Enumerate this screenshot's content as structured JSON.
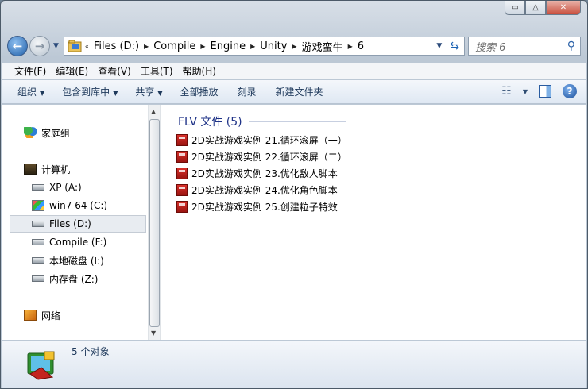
{
  "caption": {
    "minimize": "▭",
    "maximize": "△",
    "close": "✕"
  },
  "address": {
    "crumbs": [
      "Files (D:)",
      "Compile",
      "Engine",
      "Unity",
      "游戏蛮牛",
      "6"
    ]
  },
  "search": {
    "placeholder": "搜索 6"
  },
  "menu": [
    "文件(F)",
    "编辑(E)",
    "查看(V)",
    "工具(T)",
    "帮助(H)"
  ],
  "toolbar": {
    "organize": "组织",
    "include_library": "包含到库中",
    "share": "共享",
    "play_all": "全部播放",
    "burn": "刻录",
    "new_folder": "新建文件夹"
  },
  "nav": {
    "homegroup": "家庭组",
    "computer": "计算机",
    "drives": [
      "XP (A:)",
      "win7 64 (C:)",
      "Files (D:)",
      "Compile (F:)",
      "本地磁盘 (I:)",
      "内存盘 (Z:)"
    ],
    "network": "网络"
  },
  "files": {
    "group_header": "FLV 文件 (5)",
    "items": [
      "2D实战游戏实例 21.循环滚屏（一）",
      "2D实战游戏实例 22.循环滚屏（二）",
      "2D实战游戏实例 23.优化敌人脚本",
      "2D实战游戏实例 24.优化角色脚本",
      "2D实战游戏实例 25.创建粒子特效"
    ]
  },
  "details": {
    "count": "5 个对象"
  },
  "colors": {
    "header_blue": "#1e3287",
    "flv_red": "#c4241f"
  }
}
